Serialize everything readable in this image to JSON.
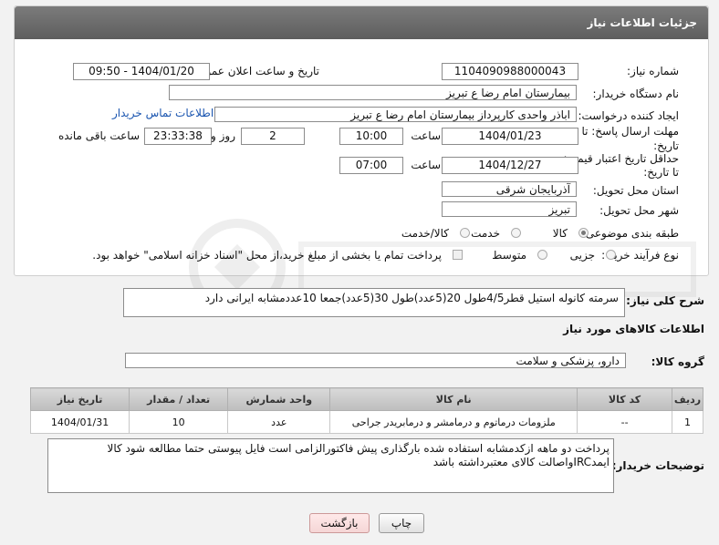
{
  "header": {
    "title": "جزئیات اطلاعات نیاز"
  },
  "fields": {
    "need_number_label": "شماره نیاز:",
    "need_number": "1104090988000043",
    "announce_label": "تاریخ و ساعت اعلان عمومی:",
    "announce_value": "1404/01/20 - 09:50",
    "buyer_label": "نام دستگاه خریدار:",
    "buyer_value": "بیمارستان امام رضا  ع  تبریز",
    "creator_label": "ایجاد کننده درخواست:",
    "creator_value": "اباذر واحدی کارپرداز بیمارستان امام رضا  ع  تبریز",
    "contact_link": "اطلاعات تماس خریدار",
    "deadline_label_1": "مهلت ارسال پاسخ: تا",
    "deadline_label_2": "تاریخ:",
    "deadline_date": "1404/01/23",
    "time_label": "ساعت",
    "deadline_time": "10:00",
    "days_value": "2",
    "days_label": "روز و",
    "remaining_time": "23:33:38",
    "remaining_label": "ساعت باقی مانده",
    "min_validity_label_1": "حداقل تاریخ اعتبار قیمت:",
    "min_validity_label_2": "تا تاریخ:",
    "validity_date": "1404/12/27",
    "validity_time": "07:00",
    "province_label": "استان محل تحویل:",
    "province_value": "آذربایجان شرقی",
    "city_label": "شهر محل تحویل:",
    "city_value": "تبریز",
    "category_label": "طبقه بندی موضوعی:",
    "category_options": [
      "کالا",
      "خدمت",
      "کالا/خدمت"
    ],
    "process_label": "نوع فرآیند خرید :",
    "process_options": [
      "جزیی",
      "متوسط"
    ],
    "payment_note": "پرداخت تمام یا بخشی از مبلغ خرید،از محل \"اسناد خزانه اسلامی\" خواهد بود."
  },
  "summary": {
    "label": "شرح کلی نیاز:",
    "value": "سرمته کانوله استیل قطر4/5طول 20(5عدد)طول 30(5عدد)جمعا 10عددمشابه ایرانی دارد"
  },
  "goods": {
    "section_title": "اطلاعات کالاهای مورد نیاز",
    "group_label": "گروه کالا:",
    "group_value": "دارو، پزشکی و سلامت",
    "columns": [
      "ردیف",
      "کد کالا",
      "نام کالا",
      "واحد شمارش",
      "تعداد / مقدار",
      "تاریخ نیاز"
    ],
    "rows": [
      {
        "row": "1",
        "code": "--",
        "name": "ملزومات درماتوم و درمامشر و درمابریدر جراحی",
        "unit": "عدد",
        "qty": "10",
        "date": "1404/01/31"
      }
    ]
  },
  "buyer_notes": {
    "label": "توضیحات خریدار:",
    "line1": "پرداخت دو ماهه ازکدمشابه استفاده شده بارگذاری پیش فاکتورالزامی است فایل پیوستی حتما مطالعه شود کالا",
    "line2": "ایمدIRCواصالت کالای معتبرداشته باشد"
  },
  "buttons": {
    "print": "چاپ",
    "back": "بازگشت"
  },
  "colors": {
    "header_bg": "#6b6b6b",
    "link": "#1a55b0",
    "back_button": "#f5d6d6"
  }
}
